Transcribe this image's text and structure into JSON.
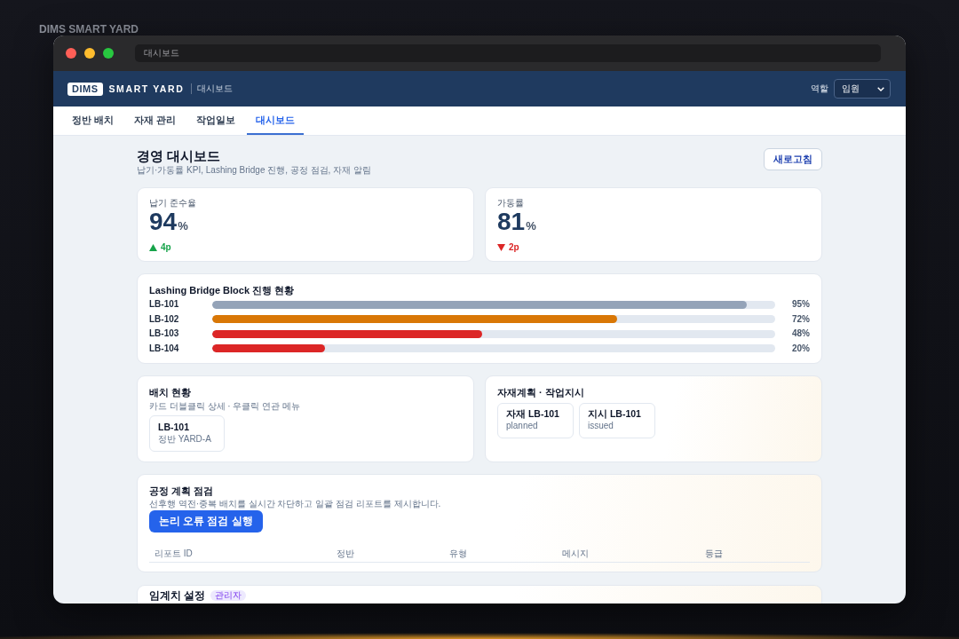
{
  "backdrop_title": "DIMS SMART YARD",
  "window": {
    "address": "대시보드"
  },
  "header": {
    "logo_badge": "DIMS",
    "logo_text": "SMART YARD",
    "page": "대시보드",
    "role_label": "역할",
    "role_value": "임원"
  },
  "tabs": [
    {
      "label": "정반 배치",
      "selected": false
    },
    {
      "label": "자재 관리",
      "selected": false
    },
    {
      "label": "작업일보",
      "selected": false
    },
    {
      "label": "대시보드",
      "selected": true
    }
  ],
  "dashboard": {
    "title": "경영 대시보드",
    "subtitle": "납기·가동률 KPI, Lashing Bridge 진행, 공정 점검, 자재 알림",
    "refresh_button": "새로고침"
  },
  "kpis": [
    {
      "label": "납기 준수율",
      "value": "94",
      "unit": "%",
      "kind": "up",
      "delta": "4p"
    },
    {
      "label": "가동률",
      "value": "81",
      "unit": "%",
      "kind": "down",
      "delta": "2p"
    }
  ],
  "progress": {
    "title": "Lashing Bridge Block 진행 현황",
    "rows": [
      {
        "name": "LB-101",
        "level": 0.95,
        "reading": "95%",
        "color": "#94a3b8"
      },
      {
        "name": "LB-102",
        "level": 0.72,
        "reading": "72%",
        "color": "#d97706"
      },
      {
        "name": "LB-103",
        "level": 0.48,
        "reading": "48%",
        "color": "#dc2626"
      },
      {
        "name": "LB-104",
        "level": 0.2,
        "reading": "20%",
        "color": "#dc2626"
      }
    ]
  },
  "placement": {
    "title": "배치 현황",
    "subtitle": "카드 더블클릭 상세 · 우클릭 연관 메뉴",
    "cards": [
      {
        "name": "LB-101",
        "detail": "정반 YARD-A"
      }
    ]
  },
  "materials": {
    "title": "자재계획 · 작업지시",
    "cards": [
      {
        "name": "자재 LB-101",
        "status": "planned"
      },
      {
        "name": "지시 LB-101",
        "status": "issued"
      }
    ]
  },
  "process_check": {
    "title": "공정 계획 점검",
    "description": "선후행 역전·중복 배치를 실시간 차단하고 일괄 점검 리포트를 제시합니다.",
    "run_button": "논리 오류 점검 실행",
    "table": {
      "columns": [
        "리포트 ID",
        "정반",
        "유형",
        "메시지",
        "등급"
      ]
    }
  },
  "threshold": {
    "title": "임계치 설정",
    "badge": "관리자"
  }
}
